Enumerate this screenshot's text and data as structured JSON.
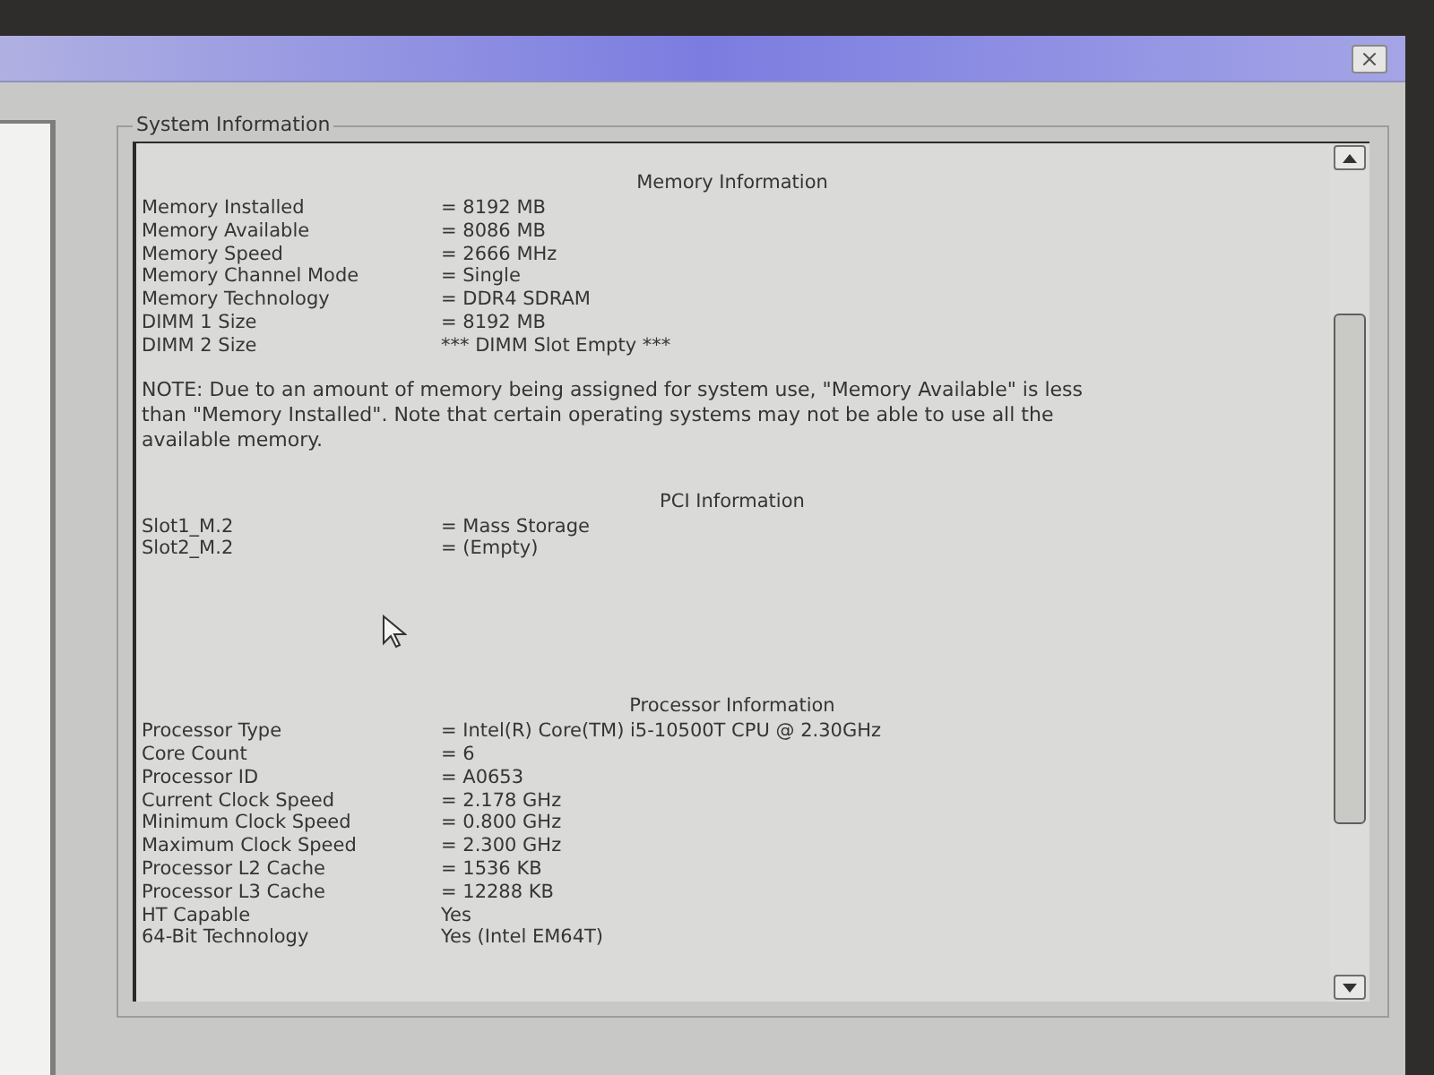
{
  "group_box": {
    "title": "System Information"
  },
  "sections": [
    {
      "heading": "Memory Information",
      "rows": [
        {
          "label": "Memory Installed",
          "value": "= 8192 MB"
        },
        {
          "label": "Memory Available",
          "value": "= 8086 MB"
        },
        {
          "label": "Memory Speed",
          "value": "= 2666 MHz"
        },
        {
          "label": "Memory Channel Mode",
          "value": "= Single"
        },
        {
          "label": "Memory Technology",
          "value": "= DDR4 SDRAM"
        },
        {
          "label": "DIMM 1 Size",
          "value": "= 8192 MB"
        },
        {
          "label": "DIMM 2 Size",
          "value": "*** DIMM Slot Empty ***"
        }
      ],
      "note": "NOTE: Due to an amount of memory being assigned for system use, \"Memory Available\" is less than \"Memory Installed\". Note that certain operating systems may not be able to use all the available memory."
    },
    {
      "heading": "PCI Information",
      "rows": [
        {
          "label": "Slot1_M.2",
          "value": "= Mass Storage"
        },
        {
          "label": "Slot2_M.2",
          "value": "= (Empty)"
        }
      ]
    },
    {
      "heading": "Processor Information",
      "rows": [
        {
          "label": "Processor Type",
          "value": "= Intel(R) Core(TM) i5-10500T CPU @ 2.30GHz"
        },
        {
          "label": "Core Count",
          "value": "= 6"
        },
        {
          "label": "Processor ID",
          "value": "= A0653"
        },
        {
          "label": "Current Clock Speed",
          "value": "= 2.178 GHz"
        },
        {
          "label": "Minimum Clock Speed",
          "value": "= 0.800 GHz"
        },
        {
          "label": "Maximum Clock Speed",
          "value": "= 2.300 GHz"
        },
        {
          "label": "Processor L2 Cache",
          "value": "= 1536 KB"
        },
        {
          "label": "Processor L3 Cache",
          "value": "= 12288 KB"
        },
        {
          "label": "HT Capable",
          "value": "Yes"
        },
        {
          "label": "64-Bit Technology",
          "value": "Yes (Intel EM64T)"
        }
      ]
    }
  ]
}
